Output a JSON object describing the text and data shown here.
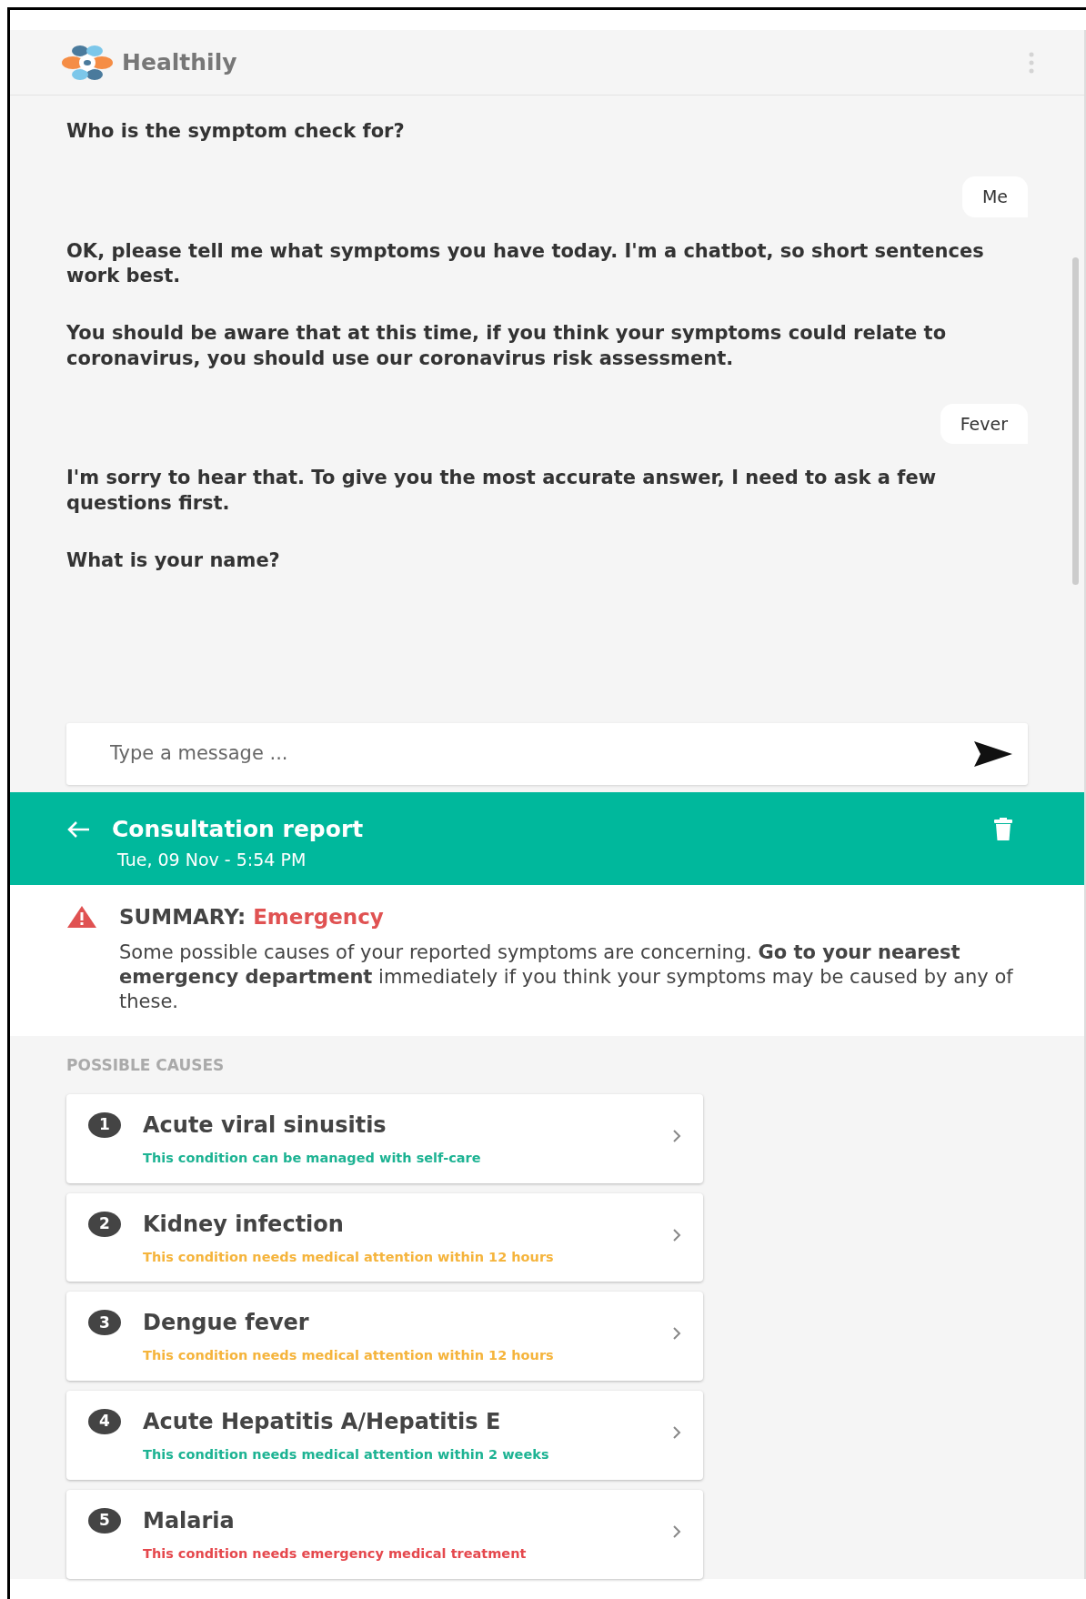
{
  "header": {
    "brand": "Healthily"
  },
  "messages": [
    {
      "kind": "bot",
      "text": "Who is the symptom check for?"
    },
    {
      "kind": "user",
      "text": "Me"
    },
    {
      "kind": "bot",
      "text": "OK, please tell me what symptoms you have today. I'm a chatbot, so short sentences work best."
    },
    {
      "kind": "bot",
      "text": "You should be aware that at this time, if you think your symptoms could relate to coronavirus, you should use our coronavirus risk assessment."
    },
    {
      "kind": "user",
      "text": "Fever"
    },
    {
      "kind": "bot",
      "text": "I'm sorry to hear that. To give you the most accurate answer, I need to ask a few questions first."
    },
    {
      "kind": "bot",
      "text": "What is your name?"
    }
  ],
  "composer": {
    "placeholder": "Type a message ..."
  },
  "report": {
    "title": "Consultation report",
    "date": "Tue, 09 Nov - 5:54 PM"
  },
  "summary": {
    "label": "SUMMARY:",
    "level": "Emergency",
    "text": "Some possible causes of your reported symptoms are concerning. **Go to your nearest emergency department** immediately if you think your symptoms may be caused by any of these."
  },
  "causes_heading": "POSSIBLE CAUSES",
  "causes": [
    {
      "number": "1",
      "name": "Acute viral sinusitis",
      "advice": "This condition can be managed with self-care",
      "color": "#1db393"
    },
    {
      "number": "2",
      "name": "Kidney infection",
      "advice": "This condition needs medical attention within 12 hours",
      "color": "#f5b43c"
    },
    {
      "number": "3",
      "name": "Dengue fever",
      "advice": "This condition needs medical attention within 12 hours",
      "color": "#f5b43c"
    },
    {
      "number": "4",
      "name": "Acute Hepatitis A/Hepatitis E",
      "advice": "This condition needs medical attention within 2 weeks",
      "color": "#1db393"
    },
    {
      "number": "5",
      "name": "Malaria",
      "advice": "This condition needs emergency medical treatment",
      "color": "#e5484d"
    }
  ]
}
